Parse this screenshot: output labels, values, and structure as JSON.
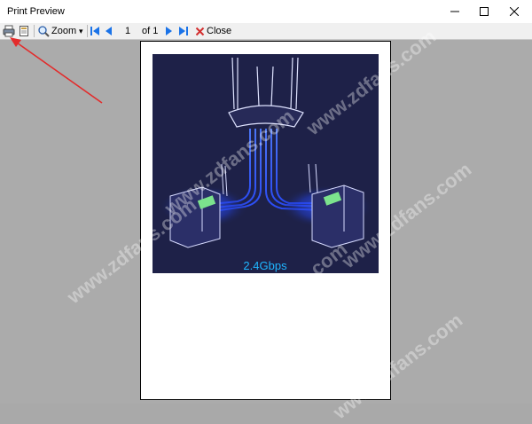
{
  "window": {
    "title": "Print Preview"
  },
  "toolbar": {
    "zoom_label": "Zoom",
    "page_value": "1",
    "page_of": "of 1",
    "close_label": "Close",
    "zoom_dropdown_glyph": "▾"
  },
  "preview": {
    "image_caption": "2.4Gbps",
    "watermark": "www.zdfans.com"
  },
  "icons": {
    "print": "printer-icon",
    "page_setup": "page-setup-icon",
    "zoom": "magnifier-icon",
    "first": "first-page-icon",
    "prev": "previous-page-icon",
    "next": "next-page-icon",
    "last": "last-page-icon",
    "close": "close-x-icon"
  },
  "colors": {
    "accent_blue": "#1a73e8",
    "close_red": "#d32f2f",
    "annotation_arrow": "#e32b2b",
    "art_background": "#1e2148",
    "art_glow": "#2f56ff",
    "caption_color": "#1fb6ff"
  }
}
